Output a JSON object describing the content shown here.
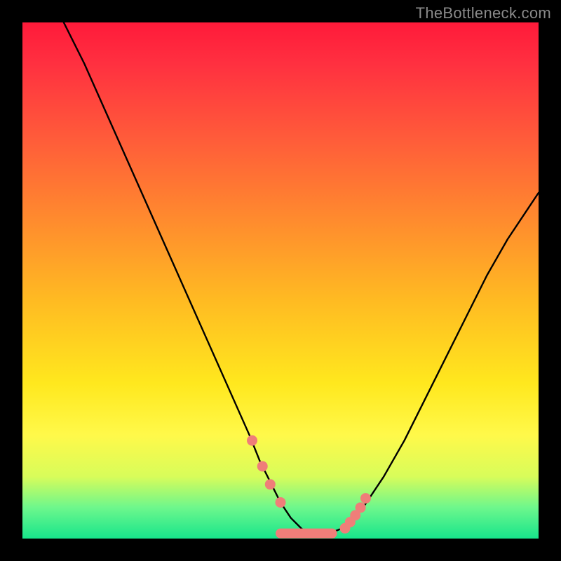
{
  "watermark": "TheBottleneck.com",
  "colors": {
    "background": "#000000",
    "curve_stroke": "#000000",
    "marker_fill": "#ef7e79",
    "watermark_text": "#8a8a8a"
  },
  "chart_data": {
    "type": "line",
    "title": "",
    "xlabel": "",
    "ylabel": "",
    "xlim": [
      0,
      100
    ],
    "ylim": [
      0,
      100
    ],
    "grid": false,
    "legend": false,
    "series": [
      {
        "name": "curve",
        "x": [
          8,
          12,
          16,
          20,
          24,
          28,
          32,
          36,
          40,
          44,
          46,
          48,
          50,
          52,
          54,
          55,
          56,
          58,
          60,
          62,
          66,
          70,
          74,
          78,
          82,
          86,
          90,
          94,
          98,
          100
        ],
        "y": [
          100,
          92,
          83,
          74,
          65,
          56,
          47,
          38,
          29,
          20,
          15,
          11,
          7,
          4,
          2,
          1.2,
          1,
          1,
          1.2,
          2,
          6,
          12,
          19,
          27,
          35,
          43,
          51,
          58,
          64,
          67
        ]
      }
    ],
    "markers": [
      {
        "x": 44.5,
        "y": 19.0
      },
      {
        "x": 46.5,
        "y": 14.0
      },
      {
        "x": 48.0,
        "y": 10.5
      },
      {
        "x": 50.0,
        "y": 7.0
      },
      {
        "x": 62.5,
        "y": 2.0
      },
      {
        "x": 63.5,
        "y": 3.2
      },
      {
        "x": 64.5,
        "y": 4.5
      },
      {
        "x": 65.5,
        "y": 6.0
      },
      {
        "x": 66.5,
        "y": 7.8
      }
    ],
    "plateau_segment": {
      "x0": 50,
      "x1": 60,
      "y": 1.0
    }
  }
}
